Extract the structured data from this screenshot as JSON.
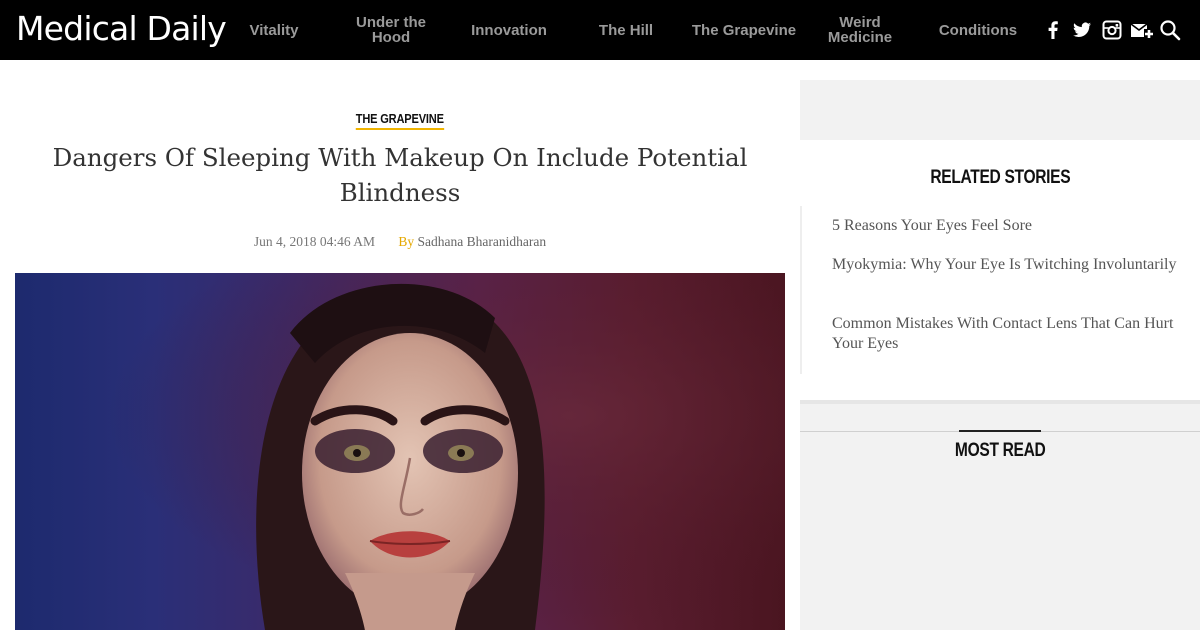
{
  "header": {
    "logo": "Medical Daily",
    "nav": [
      {
        "label": "Vitality"
      },
      {
        "label": "Under the Hood"
      },
      {
        "label": "Innovation"
      },
      {
        "label": "The Hill"
      },
      {
        "label": "The Grapevine"
      },
      {
        "label": "Weird Medicine"
      },
      {
        "label": "Conditions"
      }
    ],
    "social_icons": [
      "facebook-icon",
      "twitter-icon",
      "instagram-icon",
      "newsletter-icon",
      "search-icon"
    ]
  },
  "article": {
    "category": "THE GRAPEVINE",
    "title": "Dangers Of Sleeping With Makeup On Include Potential Blindness",
    "date": "Jun 4, 2018 04:46 AM",
    "by_label": "By",
    "author": "Sadhana Bharanidharan"
  },
  "sidebar": {
    "related_heading": "RELATED STORIES",
    "related": [
      {
        "title": "5 Reasons Your Eyes Feel Sore"
      },
      {
        "title": "Myokymia: Why Your Eye Is Twitching Involuntarily"
      },
      {
        "title": "Common Mistakes With Contact Lens That Can Hurt Your Eyes"
      }
    ],
    "most_read_heading": "MOST READ"
  },
  "colors": {
    "header_bg": "#000000",
    "accent": "#f0b400",
    "sidebar_bg": "#f2f2f2"
  }
}
